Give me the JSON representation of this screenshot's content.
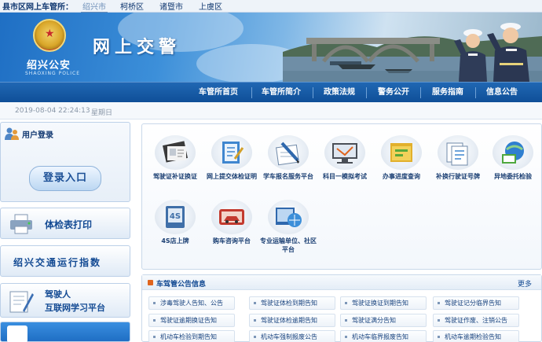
{
  "topbar": {
    "lead": "县市区网上车管所：",
    "cities": [
      "绍兴市",
      "柯桥区",
      "诸暨市",
      "上虞区"
    ],
    "active_city": "绍兴市"
  },
  "banner": {
    "brand_cn": "绍兴公安",
    "brand_en": "SHAOXING POLICE",
    "title": "网上交警"
  },
  "nav": {
    "items": [
      "车管所首页",
      "车管所简介",
      "政策法规",
      "警务公开",
      "服务指南",
      "信息公告"
    ]
  },
  "daterow": {
    "datetime": "2019-08-04 22:24:13",
    "weekday": "星期日"
  },
  "sidebar": {
    "login_title": "用户登录",
    "login_button": "登录入口",
    "exam_print": "体检表打印",
    "traffic_index": "绍兴交通运行指数",
    "learning_line1": "驾驶人",
    "learning_line2": "互联网学习平台"
  },
  "services": [
    {
      "label": "驾驶证补证换证",
      "icon": "license-card-icon"
    },
    {
      "label": "网上提交体检证明",
      "icon": "medical-doc-icon"
    },
    {
      "label": "学车报名服务平台",
      "icon": "signup-pen-icon"
    },
    {
      "label": "科目一模拟考试",
      "icon": "exam-monitor-icon"
    },
    {
      "label": "办事进度查询",
      "icon": "progress-folder-icon"
    },
    {
      "label": "补换行驶证号牌",
      "icon": "plate-docs-icon"
    },
    {
      "label": "异地委托检验",
      "icon": "remote-inspection-icon"
    },
    {
      "label": "4S店上牌",
      "icon": "dealer-plate-icon"
    },
    {
      "label": "购车咨询平台",
      "icon": "car-consult-icon"
    },
    {
      "label": "专业运输单位、社区平台",
      "icon": "transport-globe-icon"
    }
  ],
  "notice": {
    "title": "车驾管公告信息",
    "more": "更多",
    "links": [
      "涉毒驾驶人告知、公告",
      "驾驶证体检到期告知",
      "驾驶证换证到期告知",
      "驾驶证记分临界告知",
      "驾驶证逾期换证告知",
      "驾驶证体检逾期告知",
      "驾驶证满分告知",
      "驾驶证作废、注销公告",
      "机动车检验到期告知",
      "机动车强制报废公告",
      "机动车临界报废告知",
      "机动车逾期检验告知"
    ]
  },
  "colors": {
    "nav_blue": "#0f4f98",
    "text_blue": "#134a93",
    "notice_accent": "#e0651e"
  }
}
